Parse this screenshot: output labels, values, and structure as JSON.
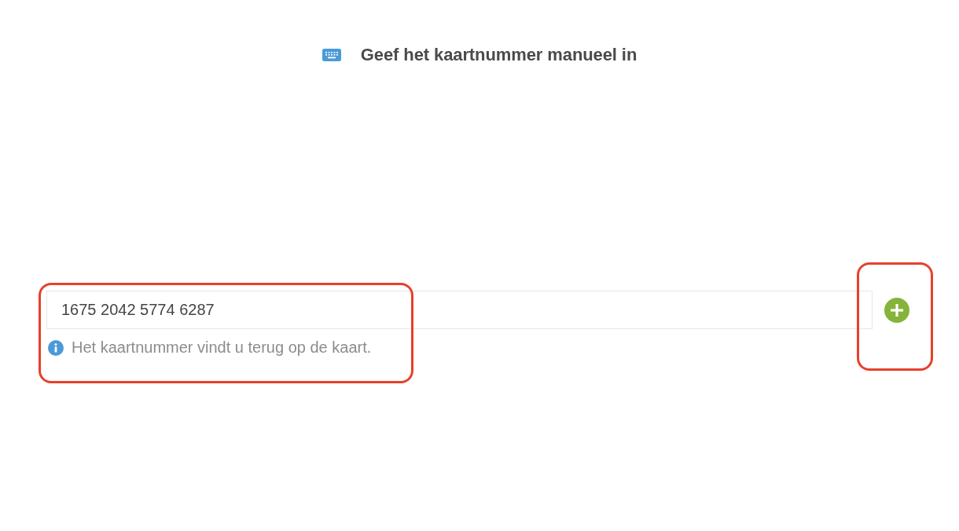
{
  "header": {
    "title": "Geef het kaartnummer manueel in"
  },
  "card_field": {
    "value": "1675 2042 5774 6287",
    "hint": "Het kaartnummer vindt u terug op de kaart.",
    "highlighted": true
  },
  "add_button": {
    "highlighted": true
  }
}
